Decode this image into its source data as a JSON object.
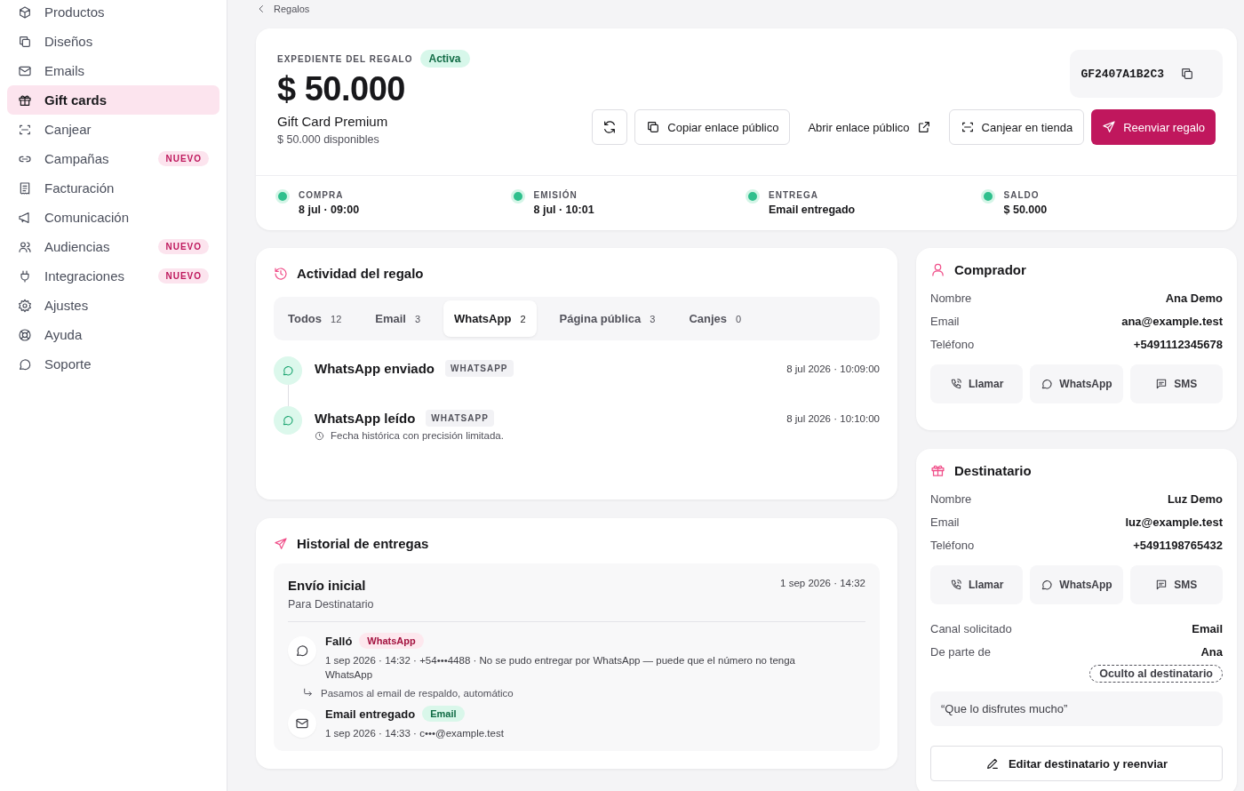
{
  "sidebar": {
    "items": [
      {
        "label": "Productos",
        "selected": false
      },
      {
        "label": "Diseños",
        "selected": false
      },
      {
        "label": "Emails",
        "selected": false
      },
      {
        "label": "Gift cards",
        "selected": true
      },
      {
        "label": "Canjear",
        "selected": false
      },
      {
        "label": "Campañas",
        "selected": false,
        "badge": "NUEVO"
      },
      {
        "label": "Facturación",
        "selected": false
      },
      {
        "label": "Comunicación",
        "selected": false
      },
      {
        "label": "Audiencias",
        "selected": false,
        "badge": "NUEVO"
      },
      {
        "label": "Integraciones",
        "selected": false,
        "badge": "NUEVO"
      },
      {
        "label": "Ajustes",
        "selected": false
      },
      {
        "label": "Ayuda",
        "selected": false
      },
      {
        "label": "Soporte",
        "selected": false
      }
    ]
  },
  "breadcrumb": {
    "label": "Regalos"
  },
  "gift": {
    "eyebrow": "EXPEDIENTE DEL REGALO",
    "status": "Activa",
    "amount": "$ 50.000",
    "product": "Gift Card Premium",
    "available": "$ 50.000 disponibles",
    "code": "GF2407A1B2C3"
  },
  "actions": [
    {
      "kind": "icon"
    },
    {
      "kind": "outline",
      "label": "Copiar enlace público"
    },
    {
      "kind": "link",
      "label": "Abrir enlace público"
    },
    {
      "kind": "outline",
      "label": "Canjear en tienda"
    },
    {
      "kind": "primary",
      "label": "Reenviar regalo"
    }
  ],
  "timeline": [
    {
      "label": "COMPRA",
      "value": "8 jul · 09:00",
      "done": true
    },
    {
      "label": "EMISIÓN",
      "value": "8 jul · 10:01",
      "done": true
    },
    {
      "label": "ENTREGA",
      "value": "Email entregado",
      "done": true
    },
    {
      "label": "SALDO",
      "value": "$ 50.000",
      "done": true
    }
  ],
  "activity": {
    "title": "Actividad del regalo",
    "tabs": [
      {
        "label": "Todos",
        "count": "12",
        "selected": false
      },
      {
        "label": "Email",
        "count": "3",
        "selected": false
      },
      {
        "label": "WhatsApp",
        "count": "2",
        "selected": true
      },
      {
        "label": "Página pública",
        "count": "3",
        "selected": false
      },
      {
        "label": "Canjes",
        "count": "0",
        "selected": false
      }
    ],
    "events": [
      {
        "title": "WhatsApp enviado",
        "tag": "WHATSAPP",
        "time": "8 jul 2026 · 10:09:00"
      },
      {
        "title": "WhatsApp leído",
        "tag": "WHATSAPP",
        "time": "8 jul 2026 · 10:10:00",
        "note": "Fecha histórica con precisión limitada."
      }
    ]
  },
  "deliveries": {
    "title": "Historial de entregas",
    "group": {
      "title": "Envío inicial",
      "subtitle": "Para Destinatario",
      "time": "1 sep 2026 · 14:32",
      "attempts": [
        {
          "kind": "failed",
          "status": "Falló",
          "channel": "WhatsApp",
          "detail": "1 sep 2026 · 14:32 · +54•••4488 · No se pudo entregar por WhatsApp — puede que el número no tenga WhatsApp",
          "fallback": "Pasamos al email de respaldo, automático"
        },
        {
          "kind": "delivered",
          "status": "Email entregado",
          "channel": "Email",
          "detail": "1 sep 2026 · 14:33 · c•••@example.test"
        }
      ]
    }
  },
  "buyer": {
    "title": "Comprador",
    "fields": [
      {
        "label": "Nombre",
        "value": "Ana Demo"
      },
      {
        "label": "Email",
        "value": "ana@example.test"
      },
      {
        "label": "Teléfono",
        "value": "+5491112345678"
      }
    ],
    "contacts": [
      "Llamar",
      "WhatsApp",
      "SMS"
    ]
  },
  "recipient": {
    "title": "Destinatario",
    "fields": [
      {
        "label": "Nombre",
        "value": "Luz Demo"
      },
      {
        "label": "Email",
        "value": "luz@example.test"
      },
      {
        "label": "Teléfono",
        "value": "+5491198765432"
      }
    ],
    "contacts": [
      "Llamar",
      "WhatsApp",
      "SMS"
    ],
    "extra": [
      {
        "label": "Canal solicitado",
        "value": "Email"
      },
      {
        "label": "De parte de",
        "value": "Ana"
      }
    ],
    "hidden_tag": "Oculto al destinatario",
    "message": "“Que lo disfrutes mucho”",
    "edit_button": "Editar destinatario y reenviar"
  }
}
